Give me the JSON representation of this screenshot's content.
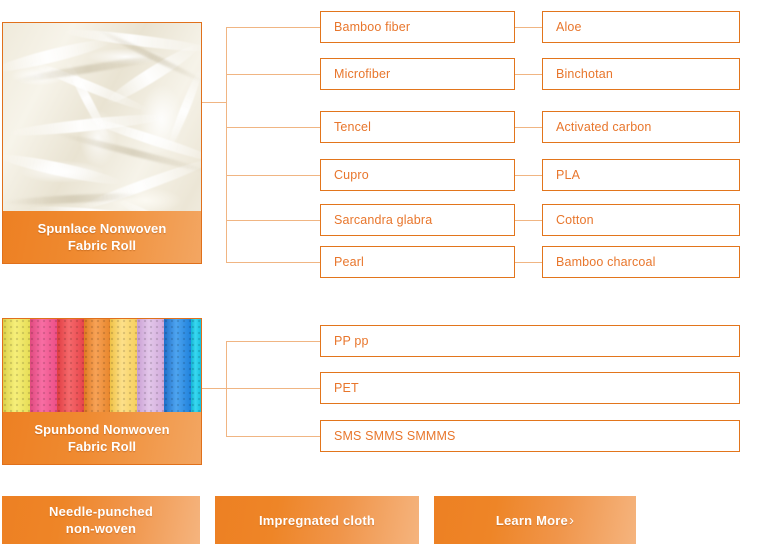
{
  "sections": [
    {
      "id": "spunlace",
      "card": {
        "caption_line1": "Spunlace Nonwoven",
        "caption_line2": "Fabric Roll",
        "photo_alt": "spunlace-fiber-photo"
      },
      "columns": [
        {
          "items": [
            "Bamboo fiber",
            "Microfiber",
            "Tencel",
            "Cupro",
            "Sarcandra glabra",
            "Pearl"
          ]
        },
        {
          "items": [
            "Aloe",
            "Binchotan",
            "Activated carbon",
            "PLA",
            "Cotton",
            "Bamboo charcoal"
          ]
        }
      ]
    },
    {
      "id": "spunbond",
      "card": {
        "caption_line1": "Spunbond Nonwoven",
        "caption_line2": "Fabric Roll",
        "photo_alt": "spunbond-roll-photo",
        "roll_colors": [
          "#F2E85C",
          "#F4558C",
          "#F0474B",
          "#ED8A2E",
          "#F9CF54",
          "#D9A8DE",
          "#2B8FE0",
          "#17C7E0"
        ]
      },
      "columns": [
        {
          "items": [
            "PP pp",
            "PET",
            "SMS SMMS SMMMS"
          ]
        }
      ]
    }
  ],
  "buttons": [
    {
      "id": "needle-punched",
      "label": "Needle-punched\nnon-woven",
      "chevron": ""
    },
    {
      "id": "impregnated-cloth",
      "label": "Impregnated cloth",
      "chevron": ""
    },
    {
      "id": "learn-more",
      "label": "Learn More",
      "chevron": "›"
    }
  ],
  "colors": {
    "accent": "#E2751C",
    "accent_text": "#E8762C",
    "line": "#F0B583",
    "caption_start": "#ED8023",
    "caption_end": "#F3A662"
  }
}
